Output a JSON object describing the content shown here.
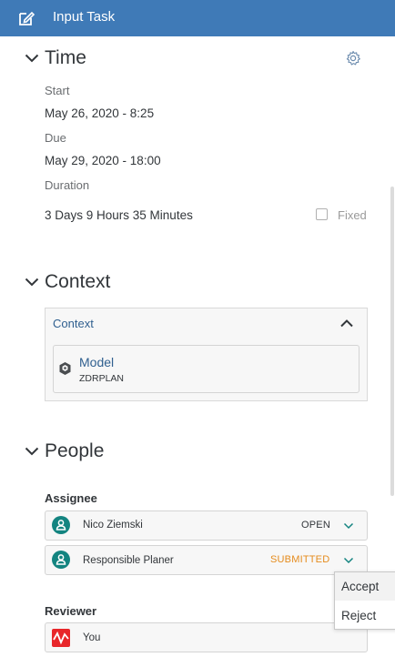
{
  "header": {
    "title": "Input Task",
    "icon": "edit-icon"
  },
  "time": {
    "section_title": "Time",
    "start_label": "Start",
    "start_value": "May 26, 2020 - 8:25",
    "due_label": "Due",
    "due_value": "May 29, 2020 - 18:00",
    "duration_label": "Duration",
    "duration_value": "3 Days 9 Hours 35 Minutes",
    "fixed_label": "Fixed",
    "fixed_checked": false
  },
  "context": {
    "section_title": "Context",
    "panel_title": "Context",
    "model": {
      "name": "Model",
      "id": "ZDRPLAN",
      "icon": "model-cube-icon"
    }
  },
  "people": {
    "section_title": "People",
    "assignee_label": "Assignee",
    "assignees": [
      {
        "name": "Nico Ziemski",
        "status": "OPEN"
      },
      {
        "name": "Responsible Planer",
        "status": "SUBMITTED"
      }
    ],
    "reviewer_label": "Reviewer",
    "reviewer": {
      "name": "You"
    },
    "status_colors": {
      "open": "#32363a",
      "submitted": "#e58b1c"
    }
  },
  "dropdown_menu": {
    "items": [
      {
        "label": "Accept"
      },
      {
        "label": "Reject"
      }
    ]
  },
  "colors": {
    "header": "#3f7ab7",
    "accent": "#138480"
  }
}
